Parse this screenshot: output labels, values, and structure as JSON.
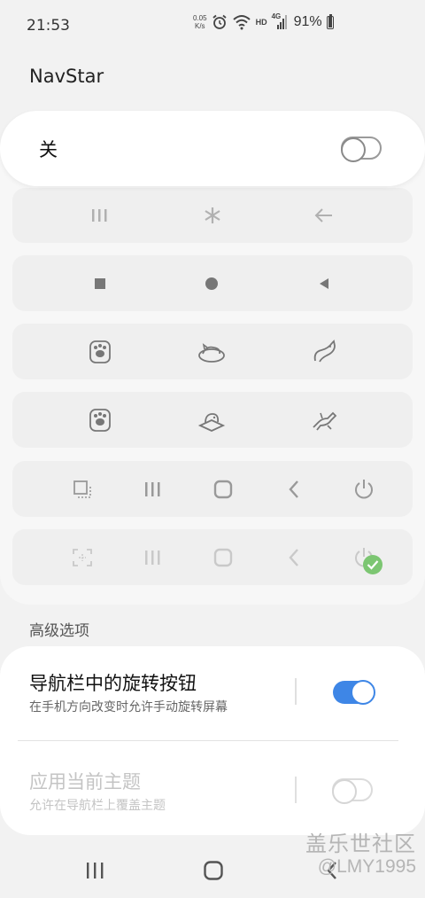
{
  "status_bar": {
    "time": "21:53",
    "net_speed_value": "0.05",
    "net_speed_unit": "K/s",
    "hd_label": "HD",
    "network_label": "4G",
    "battery_percent": "91%",
    "battery_level": 0.91,
    "icons": [
      "alarm-icon",
      "wifi-icon",
      "signal-icon",
      "battery-icon"
    ]
  },
  "header": {
    "title": "NavStar"
  },
  "master_switch": {
    "label": "关",
    "enabled": false
  },
  "style_options": [
    {
      "id": "samsung-lines",
      "icons": [
        "recents-lines-icon",
        "home-asterisk-icon",
        "back-arrow-icon"
      ],
      "selected": false
    },
    {
      "id": "aosp-shapes",
      "icons": [
        "square-icon",
        "circle-icon",
        "triangle-icon"
      ],
      "selected": false
    },
    {
      "id": "cat-paws",
      "icons": [
        "cat-paw-icon",
        "sleeping-cat-icon",
        "cat-stretch-icon"
      ],
      "selected": false
    },
    {
      "id": "dog-paws",
      "icons": [
        "dog-paw-icon",
        "sleeping-dog-icon",
        "dog-running-icon"
      ],
      "selected": false
    },
    {
      "id": "extended-5",
      "icons": [
        "screenshot-icon",
        "recents-lines-icon",
        "home-rounded-square-icon",
        "back-chevron-icon",
        "power-icon"
      ],
      "selected": false
    },
    {
      "id": "extended-5-alt",
      "icons": [
        "screenshot-dotted-icon",
        "recents-lines-icon",
        "home-rounded-square-icon",
        "back-chevron-icon",
        "power-icon"
      ],
      "selected": true
    }
  ],
  "advanced": {
    "section_label": "高级选项",
    "items": [
      {
        "title": "导航栏中的旋转按钮",
        "subtitle": "在手机方向改变时允许手动旋转屏幕",
        "enabled": true,
        "disabled": false
      },
      {
        "title": "应用当前主题",
        "subtitle": "允许在导航栏上覆盖主题",
        "enabled": false,
        "disabled": true
      }
    ]
  },
  "watermark": {
    "line1": "盖乐世社区",
    "line2": "@LMY1995"
  },
  "nav_bar": {
    "buttons": [
      "recents-icon",
      "home-icon",
      "back-icon"
    ]
  },
  "colors": {
    "accent": "#3e86e6",
    "check": "#7cc672",
    "background": "#f2f2f2",
    "card": "#ffffff"
  }
}
